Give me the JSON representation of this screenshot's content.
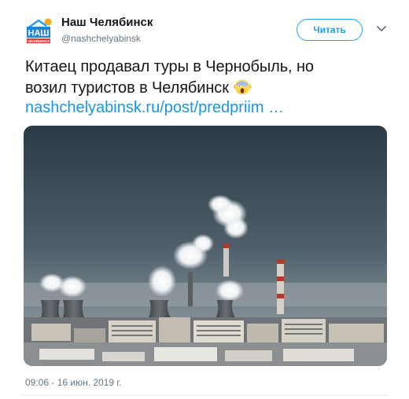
{
  "author": {
    "display_name": "Наш Челябинск",
    "handle": "@nashchelyabinsk",
    "avatar_text": "НАШ",
    "avatar_subtext": "ЧЕЛЯБИНСК"
  },
  "actions": {
    "follow_label": "Читать",
    "menu_icon": "chevron-down-icon"
  },
  "tweet": {
    "text_line1": "Китаец продавал туры в Чернобыль, но",
    "text_line2": "возил туристов в Челябинск",
    "emoji": "screaming-face-emoji",
    "link": "nashchelyabinsk.ru/post/predpriim …",
    "timestamp": "09:06 - 16 июн. 2019 г."
  },
  "colors": {
    "brand_blue": "#1da1f2",
    "link_blue": "#1b95e0",
    "secondary_text": "#657786"
  }
}
